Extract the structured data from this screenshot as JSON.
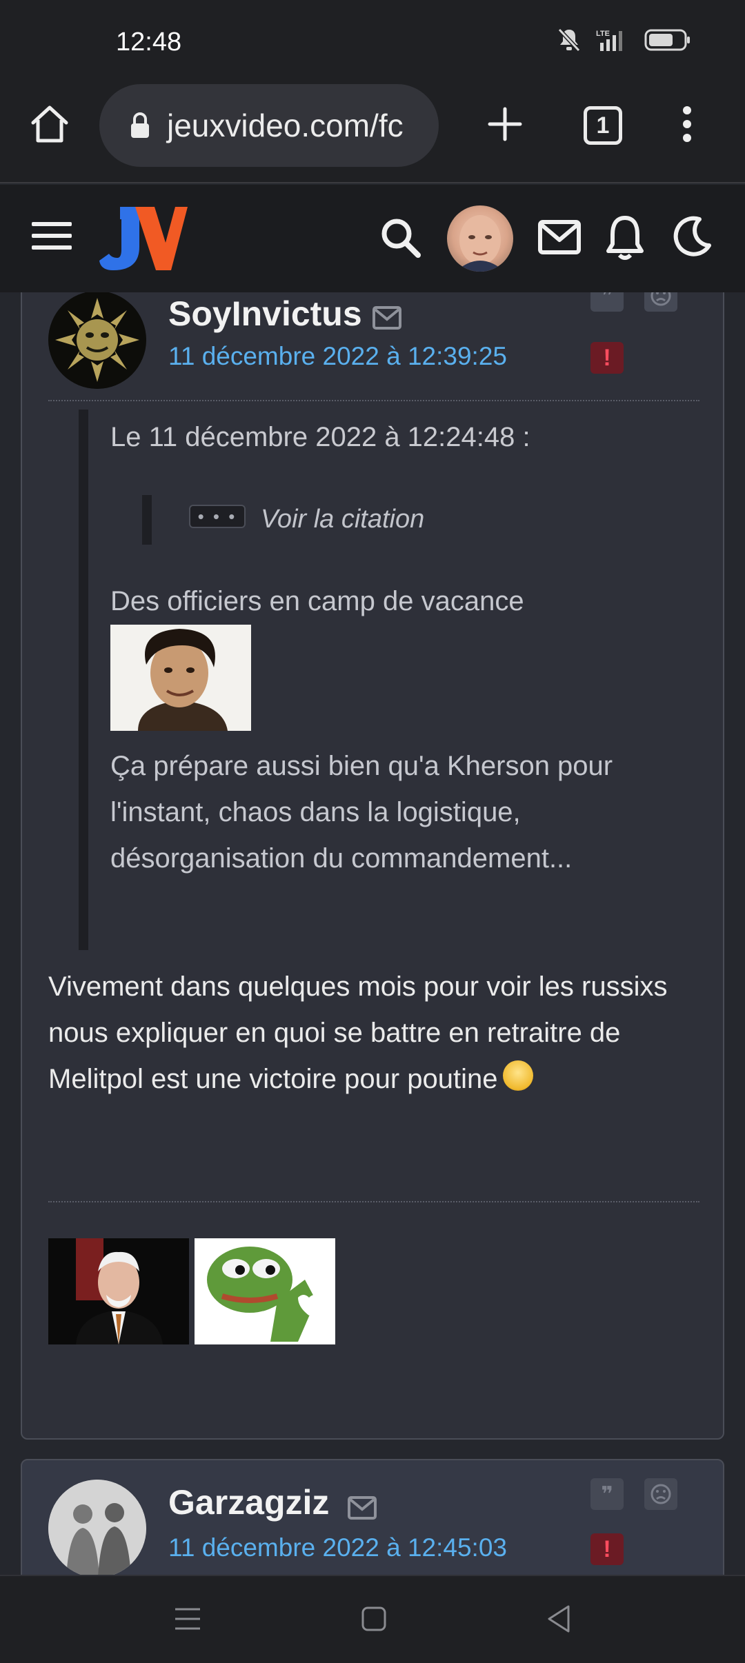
{
  "status_bar": {
    "time": "12:48",
    "network": "LTE"
  },
  "browser": {
    "url": "jeuxvideo.com/fc",
    "tab_count": "1"
  },
  "site": {
    "logo": "JV"
  },
  "posts": [
    {
      "author": "SoyInvictus",
      "date": "11 décembre 2022 à 12:39:25",
      "quote": {
        "header": "Le 11 décembre 2022 à 12:24:48 :",
        "nested_button": "• • •",
        "nested_label": "Voir la citation",
        "line1": "Des officiers en camp de vacance",
        "line2": "Ça prépare aussi bien qu'a Kherson pour l'instant, chaos dans la logistique, désorganisation du commandement..."
      },
      "body": "Vivement dans quelques mois pour voir les russixs nous expliquer en quoi se battre en retraitre de Melitpol est une victoire pour poutine"
    },
    {
      "author": "Garzagziz",
      "date": "11 décembre 2022 à 12:45:03"
    }
  ],
  "colors": {
    "link_blue": "#5ab0ee",
    "report_red": "#ff4d5f",
    "post_bg": "#2e3039",
    "header_bg": "#1b1c1f"
  },
  "icons": [
    "home-icon",
    "lock-icon",
    "plus-icon",
    "more-vert-icon",
    "menu-icon",
    "search-icon",
    "mail-icon",
    "bell-icon",
    "moon-icon",
    "quote-icon",
    "sad-face-icon",
    "report-icon"
  ]
}
